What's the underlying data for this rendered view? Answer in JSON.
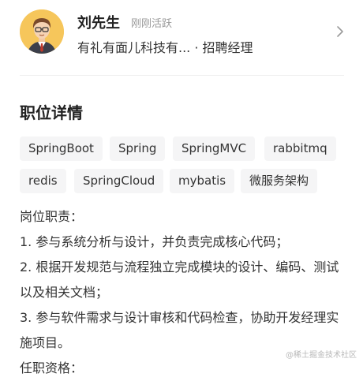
{
  "recruiter": {
    "name": "刘先生",
    "status": "刚刚活跃",
    "company": "有礼有面儿科技有... · 招聘经理"
  },
  "job_details": {
    "title": "职位详情",
    "tags": [
      "SpringBoot",
      "Spring",
      "SpringMVC",
      "rabbitmq",
      "redis",
      "SpringCloud",
      "mybatis",
      "微服务架构"
    ],
    "description_lines": [
      "岗位职责：",
      "1.  参与系统分析与设计，并负责完成核心代码；",
      "2.  根据开发规范与流程独立完成模块的设计、编码、测试以及相关文档；",
      "3.  参与软件需求与设计审核和代码检查，协助开发经理实施项目。",
      "任职资格："
    ]
  },
  "watermark": "@稀土掘金技术社区",
  "icons": {
    "avatar": "recruiter-avatar",
    "chevron": "chevron-right-icon"
  }
}
